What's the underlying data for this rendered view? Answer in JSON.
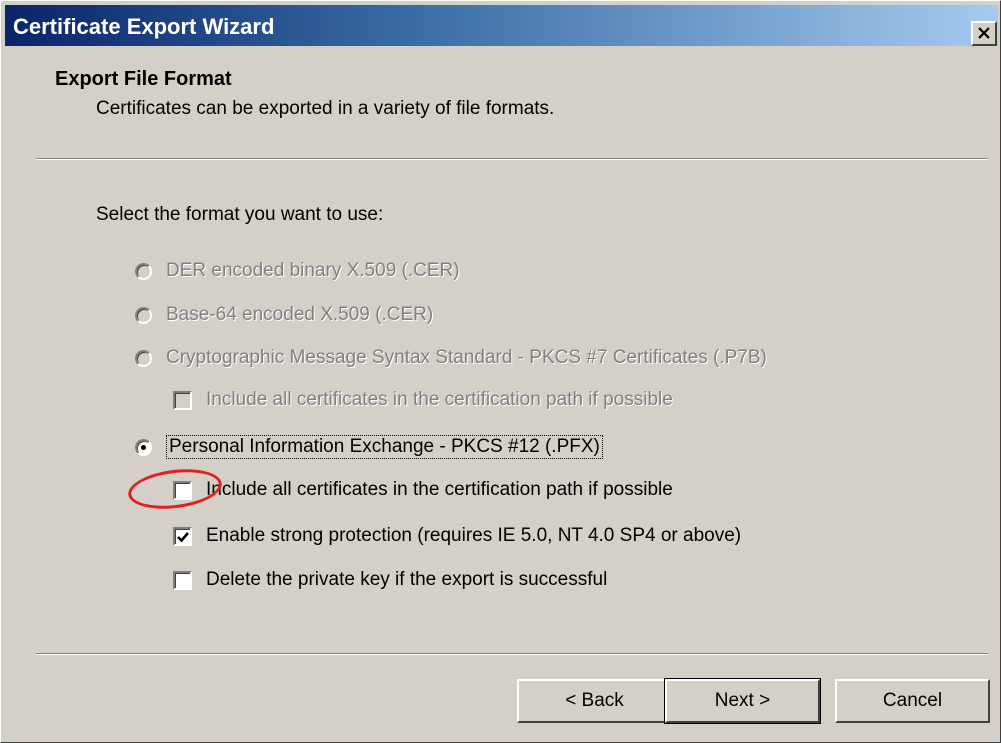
{
  "window": {
    "title": "Certificate Export Wizard",
    "close_glyph": "✕"
  },
  "header": {
    "title": "Export File Format",
    "subtitle": "Certificates can be exported in a variety of file formats."
  },
  "prompt": "Select the format you want to use:",
  "options": {
    "der": {
      "label": "DER encoded binary X.509 (.CER)",
      "enabled": false,
      "selected": false
    },
    "base64": {
      "label": "Base-64 encoded X.509 (.CER)",
      "enabled": false,
      "selected": false
    },
    "pkcs7": {
      "label": "Cryptographic Message Syntax Standard - PKCS #7 Certificates (.P7B)",
      "enabled": false,
      "selected": false,
      "include_all": {
        "label": "Include all certificates in the certification path if possible",
        "enabled": false,
        "checked": false
      }
    },
    "pfx": {
      "label": "Personal Information Exchange - PKCS #12 (.PFX)",
      "enabled": true,
      "selected": true,
      "include_all": {
        "label": "Include all certificates in the certification path if possible",
        "checked": false
      },
      "strong_protection": {
        "label": "Enable strong protection (requires IE 5.0, NT 4.0 SP4 or above)",
        "checked": true
      },
      "delete_private_key": {
        "label": "Delete the private key if the export is successful",
        "checked": false
      }
    }
  },
  "buttons": {
    "back": "< Back",
    "next": "Next >",
    "cancel": "Cancel"
  },
  "annotation": {
    "color": "#e32020"
  },
  "colors": {
    "titlebar_start": "#0a246a",
    "titlebar_end": "#a6caf0",
    "face": "#d4d0c8",
    "disabled_text": "#808080"
  }
}
